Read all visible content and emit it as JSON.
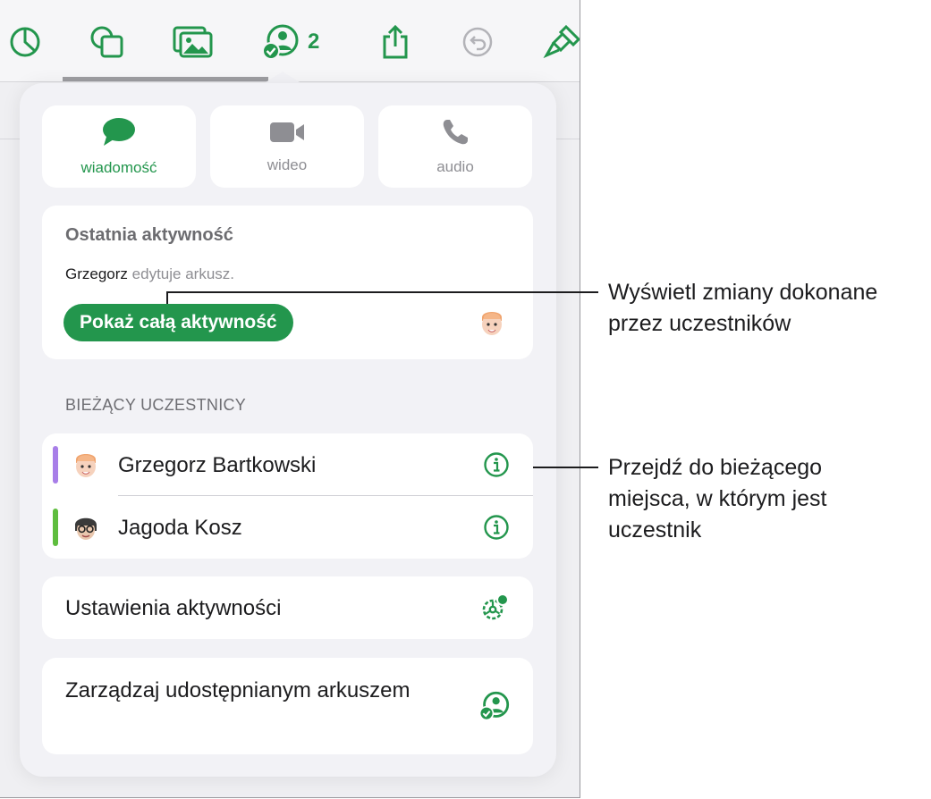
{
  "toolbar": {
    "icons": [
      "chart-icon",
      "shapes-icon",
      "media-icon",
      "collaborate-icon",
      "share-icon",
      "undo-icon",
      "format-brush-icon"
    ],
    "collaborator_count": "2",
    "accent_color": "#23964d"
  },
  "communication": {
    "message_label": "wiadomość",
    "video_label": "wideo",
    "audio_label": "audio"
  },
  "activity": {
    "title": "Ostatnia aktywność",
    "user": "Grzegorz",
    "action": "edytuje arkusz.",
    "show_all_button": "Pokaż całą aktywność"
  },
  "participants": {
    "section_title": "BIEŻĄCY UCZESTNICY",
    "items": [
      {
        "name": "Grzegorz Bartkowski",
        "bar_color": "#a87ee8"
      },
      {
        "name": "Jagoda Kosz",
        "bar_color": "#5ebd3e"
      }
    ]
  },
  "settings": {
    "label": "Ustawienia aktywności"
  },
  "manage": {
    "label": "Zarządzaj udostępnianym arkuszem"
  },
  "callouts": {
    "first": "Wyświetl zmiany dokonane przez uczestników",
    "second": "Przejdź do bieżącego miejsca, w którym jest uczestnik"
  }
}
